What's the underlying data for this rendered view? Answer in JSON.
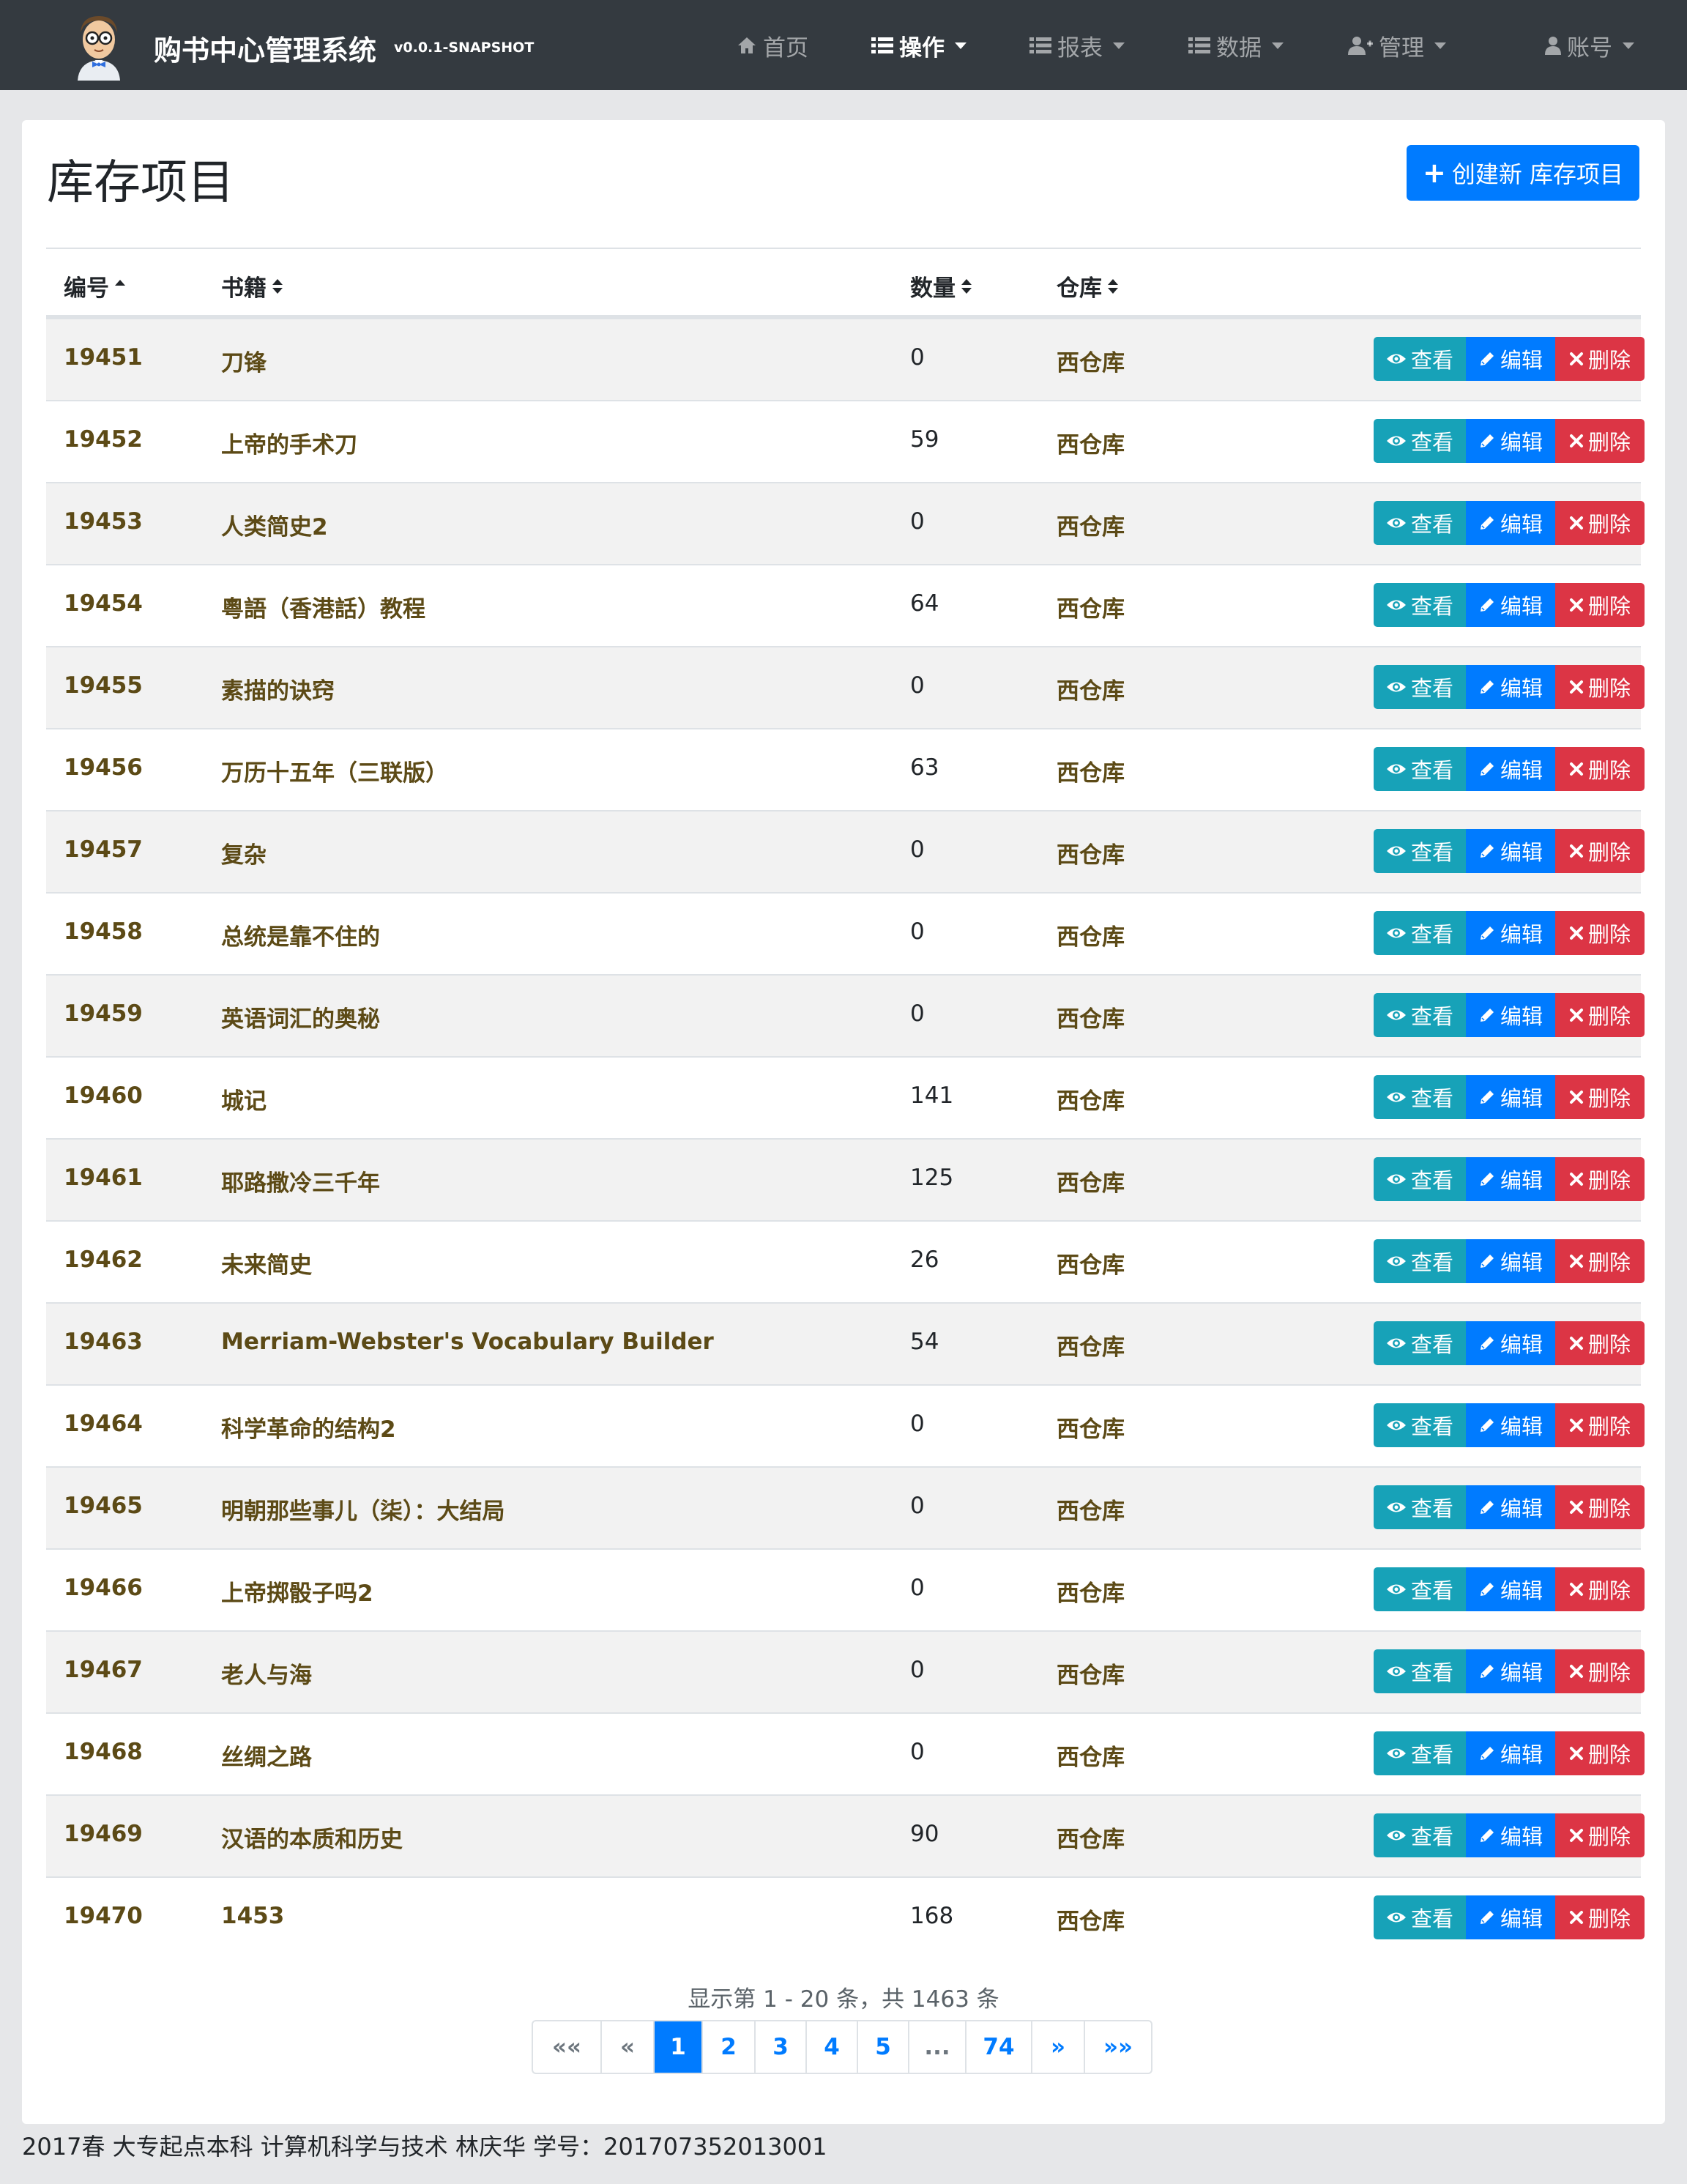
{
  "app": {
    "title": "购书中心管理系统",
    "version": "v0.0.1-SNAPSHOT"
  },
  "nav": {
    "home": "首页",
    "operations": "操作",
    "reports": "报表",
    "data": "数据",
    "admin": "管理",
    "account": "账号"
  },
  "page": {
    "title": "库存项目",
    "create_label": "创建新 库存项目"
  },
  "table": {
    "headers": {
      "id": "编号",
      "book": "书籍",
      "quantity": "数量",
      "warehouse": "仓库"
    },
    "actions": {
      "view": "查看",
      "edit": "编辑",
      "delete": "删除"
    },
    "rows": [
      {
        "id": "19451",
        "book": "刀锋",
        "quantity": "0",
        "warehouse": "西仓库"
      },
      {
        "id": "19452",
        "book": "上帝的手术刀",
        "quantity": "59",
        "warehouse": "西仓库"
      },
      {
        "id": "19453",
        "book": "人类简史2",
        "quantity": "0",
        "warehouse": "西仓库"
      },
      {
        "id": "19454",
        "book": "粵語（香港話）教程",
        "quantity": "64",
        "warehouse": "西仓库"
      },
      {
        "id": "19455",
        "book": "素描的诀窍",
        "quantity": "0",
        "warehouse": "西仓库"
      },
      {
        "id": "19456",
        "book": "万历十五年（三联版）",
        "quantity": "63",
        "warehouse": "西仓库"
      },
      {
        "id": "19457",
        "book": "复杂",
        "quantity": "0",
        "warehouse": "西仓库"
      },
      {
        "id": "19458",
        "book": "总统是靠不住的",
        "quantity": "0",
        "warehouse": "西仓库"
      },
      {
        "id": "19459",
        "book": "英语词汇的奥秘",
        "quantity": "0",
        "warehouse": "西仓库"
      },
      {
        "id": "19460",
        "book": "城记",
        "quantity": "141",
        "warehouse": "西仓库"
      },
      {
        "id": "19461",
        "book": "耶路撒冷三千年",
        "quantity": "125",
        "warehouse": "西仓库"
      },
      {
        "id": "19462",
        "book": "未来简史",
        "quantity": "26",
        "warehouse": "西仓库"
      },
      {
        "id": "19463",
        "book": "Merriam-Webster's Vocabulary Builder",
        "quantity": "54",
        "warehouse": "西仓库"
      },
      {
        "id": "19464",
        "book": "科学革命的结构2",
        "quantity": "0",
        "warehouse": "西仓库"
      },
      {
        "id": "19465",
        "book": "明朝那些事儿（柒）：大结局",
        "quantity": "0",
        "warehouse": "西仓库"
      },
      {
        "id": "19466",
        "book": "上帝掷骰子吗2",
        "quantity": "0",
        "warehouse": "西仓库"
      },
      {
        "id": "19467",
        "book": "老人与海",
        "quantity": "0",
        "warehouse": "西仓库"
      },
      {
        "id": "19468",
        "book": "丝绸之路",
        "quantity": "0",
        "warehouse": "西仓库"
      },
      {
        "id": "19469",
        "book": "汉语的本质和历史",
        "quantity": "90",
        "warehouse": "西仓库"
      },
      {
        "id": "19470",
        "book": "1453",
        "quantity": "168",
        "warehouse": "西仓库"
      }
    ]
  },
  "pagination": {
    "summary": "显示第 1 - 20 条，共 1463 条",
    "pages": [
      {
        "label": "««",
        "state": "disabled"
      },
      {
        "label": "«",
        "state": "disabled"
      },
      {
        "label": "1",
        "state": "active"
      },
      {
        "label": "2",
        "state": "normal"
      },
      {
        "label": "3",
        "state": "normal"
      },
      {
        "label": "4",
        "state": "normal"
      },
      {
        "label": "5",
        "state": "normal"
      },
      {
        "label": "...",
        "state": "disabled"
      },
      {
        "label": "74",
        "state": "normal"
      },
      {
        "label": "»",
        "state": "normal"
      },
      {
        "label": "»»",
        "state": "normal"
      }
    ]
  },
  "footer": {
    "text": "2017春 大专起点本科 计算机科学与技术 林庆华 学号：201707352013001"
  },
  "colors": {
    "navbar": "#343a40",
    "primary": "#007bff",
    "info": "#17a2b8",
    "danger": "#dc3545",
    "stripe": "#f2f2f2",
    "link_text": "#5c4a16"
  }
}
